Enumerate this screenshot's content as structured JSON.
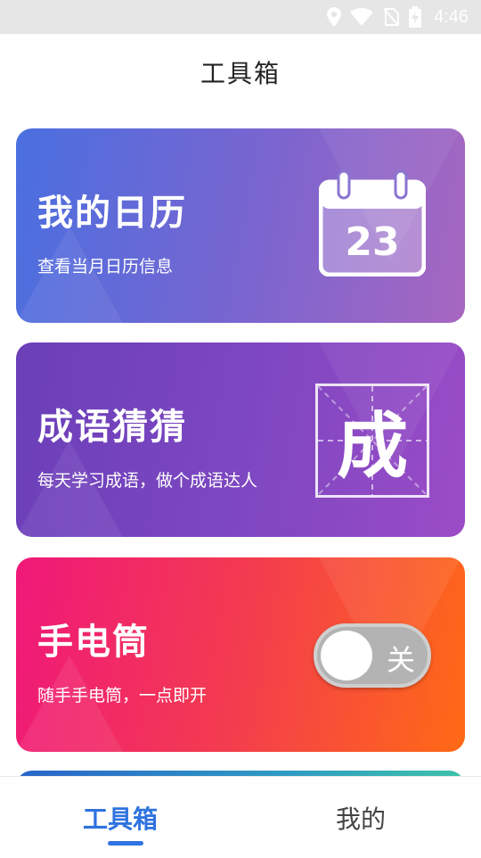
{
  "status_bar": {
    "time": "4:46",
    "icons": [
      "location-icon",
      "wifi-icon",
      "no-sim-icon",
      "battery-charging-icon"
    ]
  },
  "header": {
    "title": "工具箱"
  },
  "cards": [
    {
      "title": "我的日历",
      "subtitle": "查看当月日历信息",
      "calendar_day": "23"
    },
    {
      "title": "成语猜猜",
      "subtitle": "每天学习成语，做个成语达人",
      "idiom_char": "成"
    },
    {
      "title": "手电筒",
      "subtitle": "随手手电筒，一点即开",
      "toggle_label": "关",
      "toggle_on": false
    }
  ],
  "bottom_nav": {
    "tabs": [
      {
        "label": "工具箱",
        "active": true
      },
      {
        "label": "我的",
        "active": false
      }
    ]
  },
  "colors": {
    "accent": "#2f73e0"
  }
}
